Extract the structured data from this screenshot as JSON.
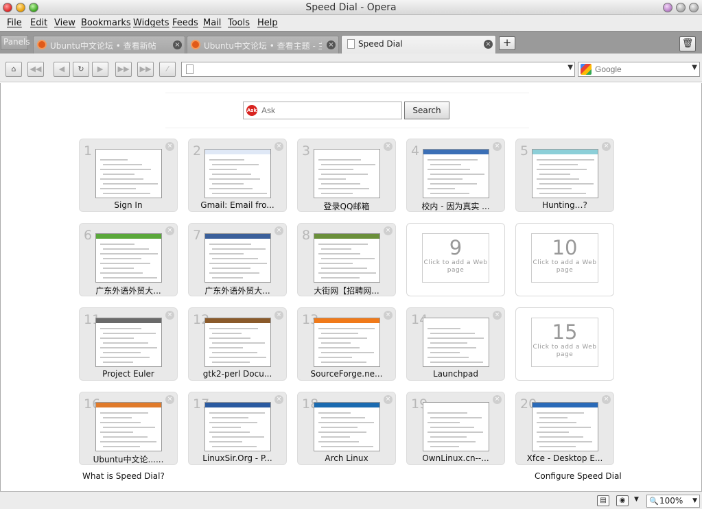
{
  "window": {
    "title": "Speed Dial - Opera"
  },
  "menu": [
    "File",
    "Edit",
    "View",
    "Bookmarks",
    "Widgets",
    "Feeds",
    "Mail",
    "Tools",
    "Help"
  ],
  "tabs": {
    "panels_label": "Panels",
    "items": [
      {
        "label": "Ubuntu中文论坛 • 查看新帖",
        "active": false
      },
      {
        "label": "Ubuntu中文论坛 • 查看主题 - 主...",
        "active": false
      },
      {
        "label": "Speed Dial",
        "active": true
      }
    ]
  },
  "address": {
    "value": ""
  },
  "search_engine": {
    "placeholder": "Google"
  },
  "ask": {
    "placeholder": "Ask",
    "button_label": "Search",
    "logo_text": "Ask"
  },
  "dials": [
    {
      "num": "1",
      "label": "Sign In",
      "bar": "#ffffff"
    },
    {
      "num": "2",
      "label": "Gmail: Email fro...",
      "bar": "#dfe8f6"
    },
    {
      "num": "3",
      "label": "登录QQ邮箱",
      "bar": "#ffffff"
    },
    {
      "num": "4",
      "label": "校内 - 因为真实 ...",
      "bar": "#3b6fb6"
    },
    {
      "num": "5",
      "label": "Hunting…?",
      "bar": "#8ccfd8"
    },
    {
      "num": "6",
      "label": "广东外语外贸大...",
      "bar": "#5aa83a"
    },
    {
      "num": "7",
      "label": "广东外语外贸大...",
      "bar": "#3a5f9a"
    },
    {
      "num": "8",
      "label": "大街网【招聘网...",
      "bar": "#6a8f3a"
    },
    {
      "num": "9",
      "label": "",
      "empty": true,
      "hint": "Click to add a Web page"
    },
    {
      "num": "10",
      "label": "",
      "empty": true,
      "hint": "Click to add a Web page"
    },
    {
      "num": "11",
      "label": "Project Euler",
      "bar": "#6a6a6a"
    },
    {
      "num": "12",
      "label": "gtk2-perl Docu...",
      "bar": "#8a5a2a"
    },
    {
      "num": "13",
      "label": "SourceForge.ne...",
      "bar": "#f07a1a"
    },
    {
      "num": "14",
      "label": "Launchpad",
      "bar": "#ffffff"
    },
    {
      "num": "15",
      "label": "",
      "empty": true,
      "hint": "Click to add a Web page"
    },
    {
      "num": "16",
      "label": "Ubuntu中文论......",
      "bar": "#e07a2a"
    },
    {
      "num": "17",
      "label": "LinuxSir.Org - P...",
      "bar": "#2a5aa0"
    },
    {
      "num": "18",
      "label": "Arch Linux",
      "bar": "#1a6ab0"
    },
    {
      "num": "19",
      "label": "OwnLinux.cn--...",
      "bar": "#ffffff"
    },
    {
      "num": "20",
      "label": "Xfce - Desktop E...",
      "bar": "#2a6ab8"
    }
  ],
  "links": {
    "what_is": "What is Speed Dial?",
    "configure": "Configure Speed Dial"
  },
  "status": {
    "zoom": "100%"
  }
}
